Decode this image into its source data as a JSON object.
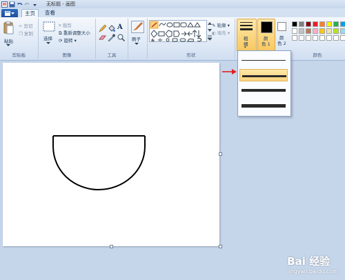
{
  "window": {
    "title": "无标题 - 画图"
  },
  "tabs": [
    {
      "label": "主页"
    },
    {
      "label": "查看"
    }
  ],
  "ribbon": {
    "clipboard": {
      "paste": "粘贴",
      "cut": "剪切",
      "copy": "复制",
      "group": "剪贴板"
    },
    "image": {
      "select": "选择",
      "crop": "裁剪",
      "resize": "重新调整大小",
      "rotate": "旋转",
      "group": "图像"
    },
    "tools": {
      "text_tool": "A",
      "group": "工具"
    },
    "brushes": {
      "label": "刷子"
    },
    "shapes": {
      "outline": "轮廓",
      "fill": "填充",
      "group": "形状"
    },
    "size": {
      "label1": "粗",
      "label2": "细"
    },
    "color1": {
      "label1": "颜",
      "label2": "色 1"
    },
    "color2": {
      "label1": "颜",
      "label2": "色 2"
    },
    "colors": {
      "group": "颜色"
    }
  },
  "size_options": [
    {
      "thickness_px": 1,
      "highlighted": false
    },
    {
      "thickness_px": 3,
      "highlighted": true
    },
    {
      "thickness_px": 4,
      "highlighted": false
    },
    {
      "thickness_px": 5,
      "highlighted": false
    }
  ],
  "palette": [
    "#000000",
    "#7f7f7f",
    "#880015",
    "#ed1c24",
    "#ff7f27",
    "#fff200",
    "#22b14c",
    "#00a2e8",
    "#ffffff",
    "#c3c3c3",
    "#b97a57",
    "#ffaec9",
    "#ffc90e",
    "#efe4b0",
    "#b5e61d",
    "#99d9ea",
    "#ffffff",
    "#ffffff",
    "#ffffff",
    "#ffffff",
    "#ffffff",
    "#ffffff",
    "#ffffff",
    "#ffffff"
  ],
  "colors": {
    "color1": "#000000",
    "color2": "#ffffff",
    "accent_red_arrow": "#e02020"
  },
  "watermark": {
    "brand": "Bai 经验",
    "url": "jingyan.baidu.com"
  }
}
